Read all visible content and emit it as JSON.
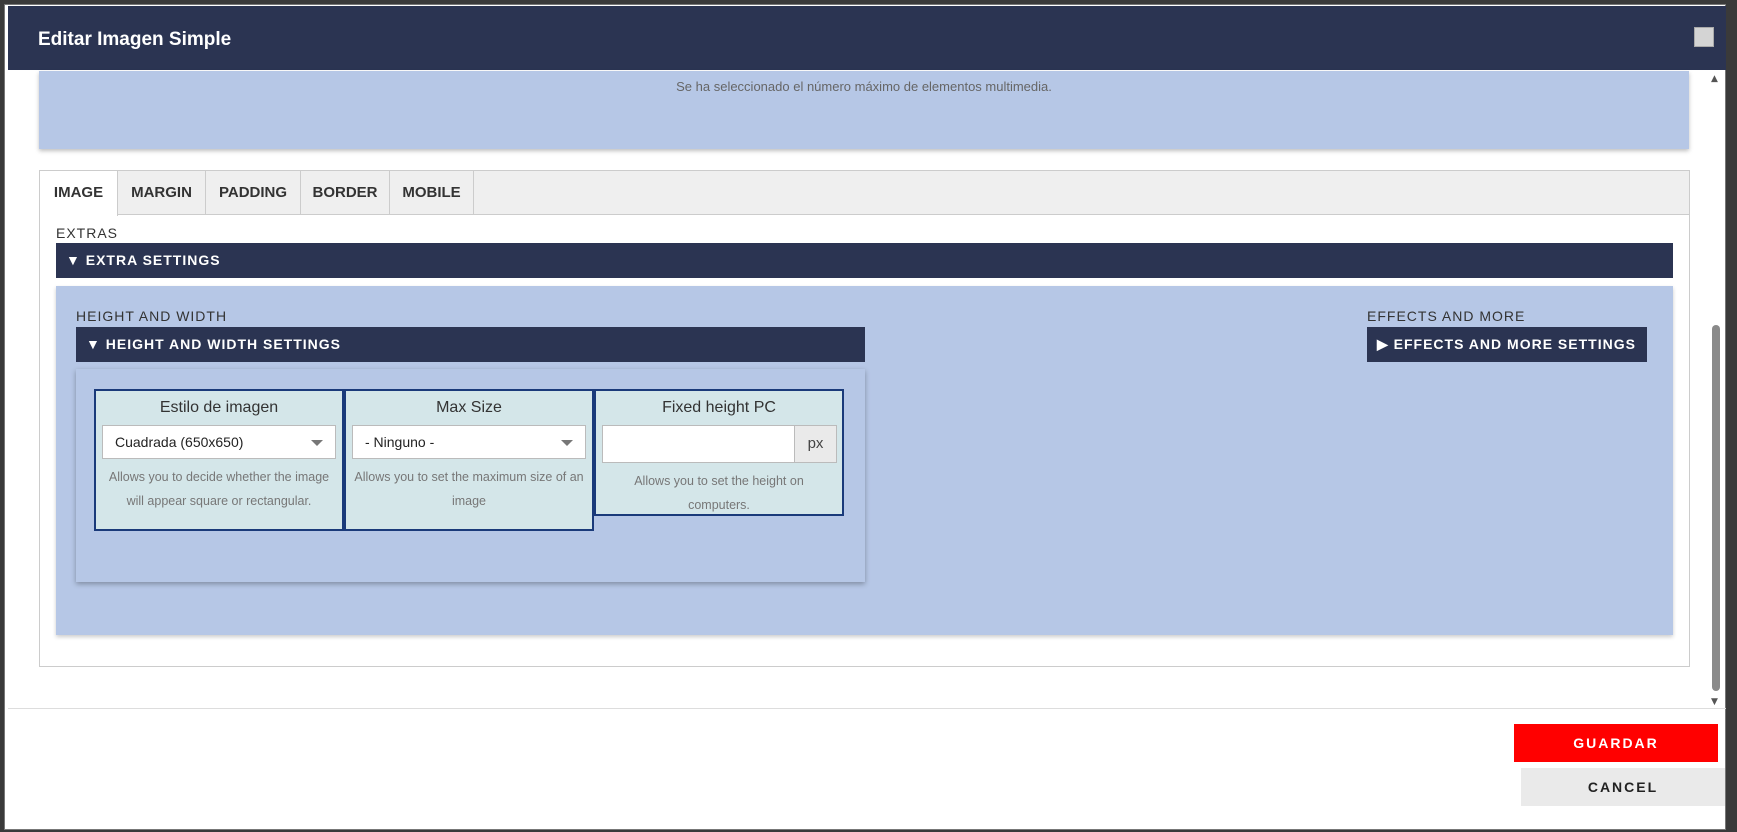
{
  "dialog": {
    "title": "Editar Imagen Simple"
  },
  "media": {
    "message": "Se ha seleccionado el número máximo de elementos multimedia."
  },
  "tabs": [
    {
      "label": "IMAGE",
      "active": true
    },
    {
      "label": "MARGIN",
      "active": false
    },
    {
      "label": "PADDING",
      "active": false
    },
    {
      "label": "BORDER",
      "active": false
    },
    {
      "label": "MOBILE",
      "active": false
    }
  ],
  "extras": {
    "label": "EXTRAS",
    "settings_title": "▼ EXTRA SETTINGS"
  },
  "height_width": {
    "label": "HEIGHT AND WIDTH",
    "settings_title": "▼ HEIGHT AND WIDTH SETTINGS",
    "fields": [
      {
        "title": "Estilo de imagen",
        "value": "Cuadrada (650x650)",
        "help": "Allows you to decide whether the image will appear square or rectangular."
      },
      {
        "title": "Max Size",
        "value": "- Ninguno -",
        "help": "Allows you to set the maximum size of an image"
      },
      {
        "title": "Fixed height PC",
        "value": "",
        "unit": "px",
        "help": "Allows you to set the height on computers."
      }
    ]
  },
  "effects": {
    "label": "EFFECTS AND MORE",
    "settings_title": "▶ EFFECTS AND MORE SETTINGS"
  },
  "footer": {
    "save_label": "GUARDAR",
    "cancel_label": "CANCEL"
  },
  "colors": {
    "header_bg": "#2b3452",
    "panel_bg": "#b6c7e6",
    "card_bg": "#d4e6e9",
    "save_bg": "#ff0000"
  }
}
